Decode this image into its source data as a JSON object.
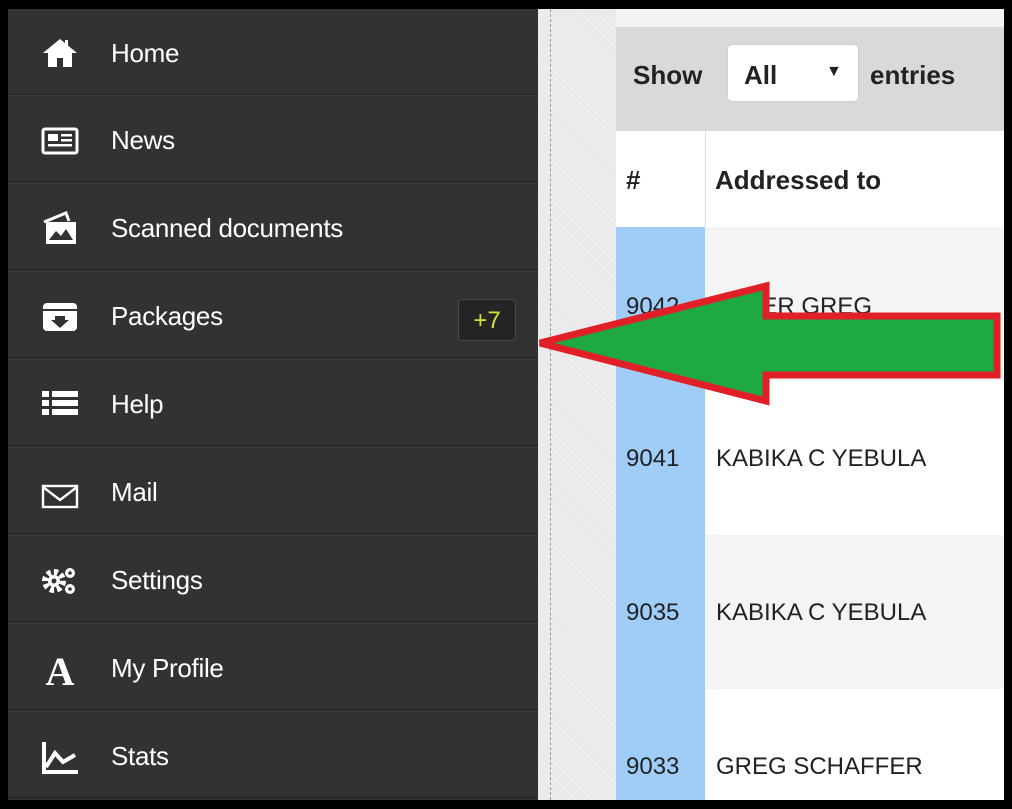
{
  "sidebar": {
    "items": [
      {
        "label": "Home",
        "icon": "home-icon"
      },
      {
        "label": "News",
        "icon": "newspaper-icon"
      },
      {
        "label": "Scanned documents",
        "icon": "scanned-docs-icon"
      },
      {
        "label": "Packages",
        "icon": "package-icon",
        "badge": "+7"
      },
      {
        "label": "Help",
        "icon": "list-icon"
      },
      {
        "label": "Mail",
        "icon": "envelope-icon"
      },
      {
        "label": "Settings",
        "icon": "gears-icon"
      },
      {
        "label": "My Profile",
        "icon": "font-a-icon"
      },
      {
        "label": "Stats",
        "icon": "line-chart-icon"
      }
    ]
  },
  "table": {
    "show_label": "Show",
    "entries_value": "All",
    "entries_label": "entries",
    "columns": [
      "#",
      "Addressed to"
    ],
    "rows": [
      {
        "id": "9042",
        "name": "AFFER GREG"
      },
      {
        "id": "9041",
        "name": "KABIKA C YEBULA"
      },
      {
        "id": "9035",
        "name": "KABIKA C YEBULA"
      },
      {
        "id": "9033",
        "name": "GREG SCHAFFER"
      }
    ]
  },
  "colors": {
    "sidebar_bg": "#323232",
    "badge_text": "#d7df3a",
    "id_column": "#9fcdf7",
    "arrow_fill": "#1fa943",
    "arrow_stroke": "#e11f26"
  }
}
